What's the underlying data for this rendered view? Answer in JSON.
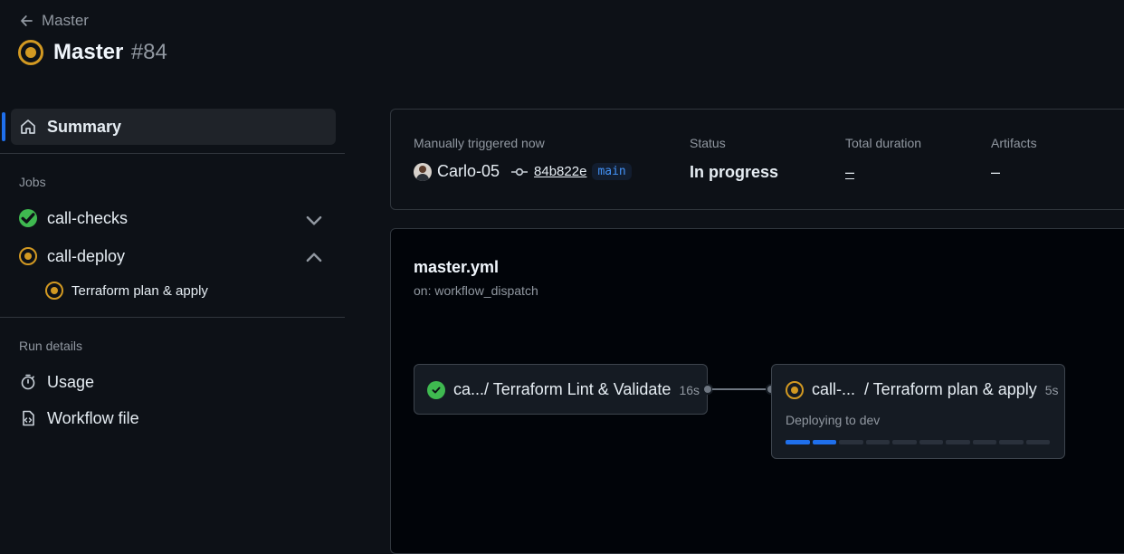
{
  "header": {
    "back_label": "Master",
    "title": "Master",
    "run_number": "#84"
  },
  "sidebar": {
    "summary_label": "Summary",
    "jobs_heading": "Jobs",
    "jobs": [
      {
        "label": "call-checks",
        "status": "success",
        "expanded": false
      },
      {
        "label": "call-deploy",
        "status": "in_progress",
        "expanded": true
      }
    ],
    "deploy_subjob": "Terraform plan & apply",
    "run_details_heading": "Run details",
    "usage_label": "Usage",
    "workflow_file_label": "Workflow file"
  },
  "summary": {
    "trigger_label": "Manually triggered now",
    "actor": "Carlo-05",
    "commit": "84b822e",
    "branch": "main",
    "status_label": "Status",
    "status_value": "In progress",
    "duration_label": "Total duration",
    "duration_value": "–",
    "artifacts_label": "Artifacts",
    "artifacts_value": "–"
  },
  "workflow": {
    "file": "master.yml",
    "trigger": "on: workflow_dispatch",
    "jobs": [
      {
        "name": "ca.../ Terraform Lint & Validate",
        "duration": "16s",
        "status": "success"
      },
      {
        "name": "call-...  / Terraform plan & apply",
        "duration": "5s",
        "status": "in_progress",
        "step": "Deploying to dev",
        "progress_segments_done": 2,
        "progress_segments_total": 10
      }
    ]
  },
  "colors": {
    "accent": "#1f6feb",
    "success": "#3fb950",
    "in_progress": "#d29922",
    "background": "#0d1117"
  }
}
